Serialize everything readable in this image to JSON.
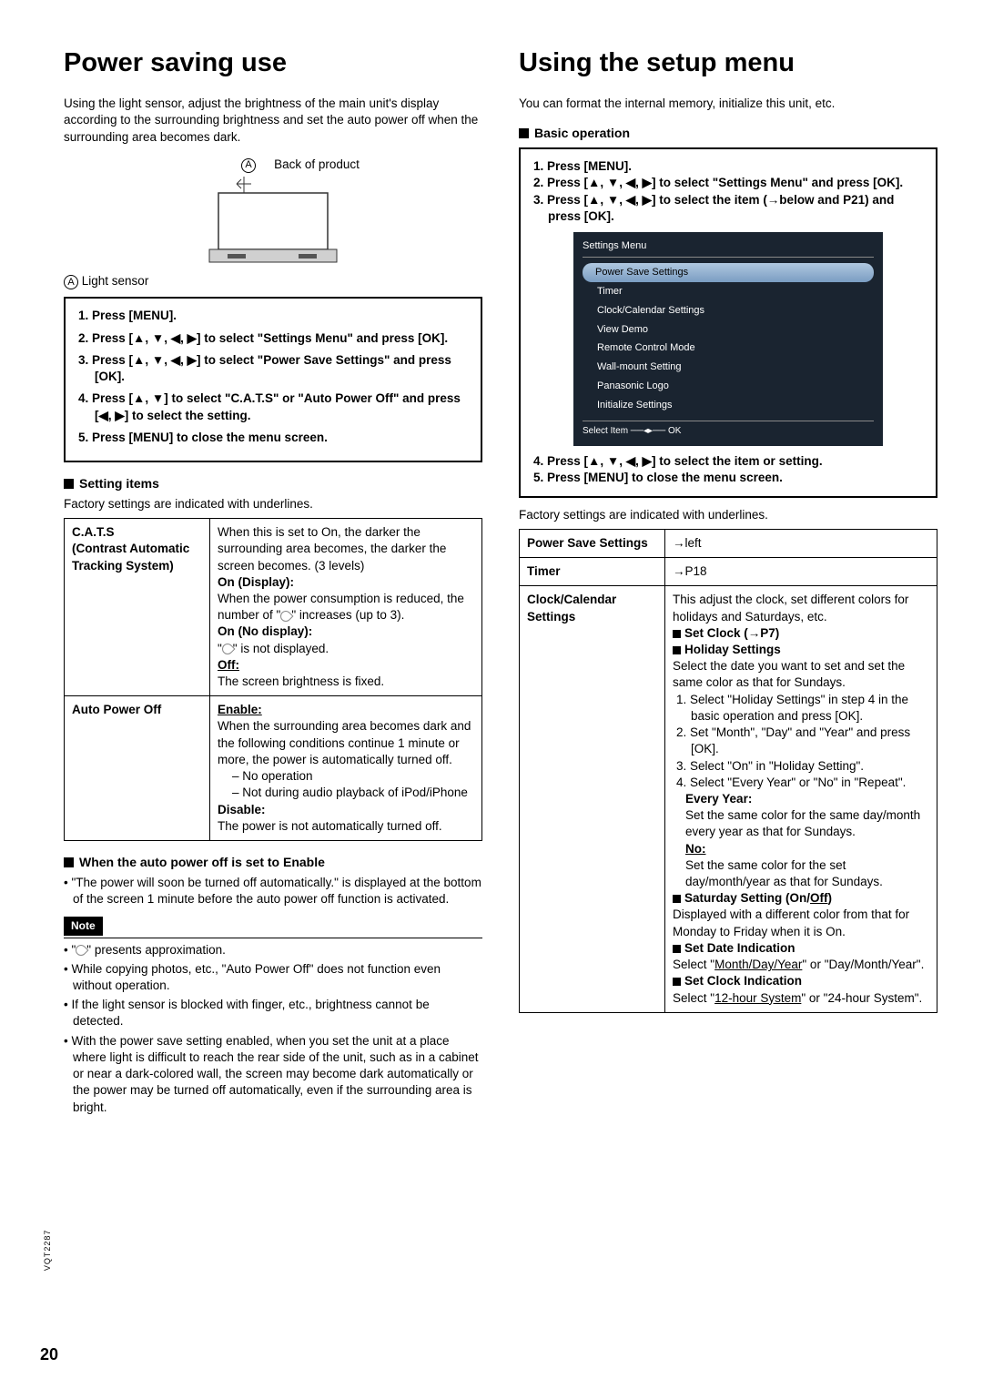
{
  "page_number": "20",
  "doc_code": "VQT2287",
  "left": {
    "title": "Power saving use",
    "intro": "Using the light sensor, adjust the brightness of the main unit's display according to the surrounding brightness and set the auto power off when the surrounding area becomes dark.",
    "back_label": "Back of product",
    "marker": "A",
    "light_sensor": "Light sensor",
    "steps": [
      "Press [MENU].",
      "Press [▲, ▼, ◀, ▶] to select \"Settings Menu\" and press [OK].",
      "Press [▲, ▼, ◀, ▶] to select \"Power Save Settings\" and press [OK].",
      "Press [▲, ▼] to select \"C.A.T.S\" or \"Auto Power Off\" and press [◀, ▶] to select the setting.",
      "Press [MENU] to close the menu screen."
    ],
    "setting_items_head": "Setting items",
    "factory_note": "Factory settings are indicated with underlines.",
    "table": {
      "cats_label": "C.A.T.S\n(Contrast Automatic Tracking System)",
      "cats_desc": {
        "p1": "When this is set to On, the darker the surrounding area becomes, the darker the screen becomes. (3 levels)",
        "on_display": "On (Display):",
        "p2a": "When the power consumption is reduced, the number of \"",
        "p2b": "\" increases (up to 3).",
        "on_nodisplay": "On (No display):",
        "p3a": "\"",
        "p3b": "\" is not displayed.",
        "off": "Off:",
        "p4": "The screen brightness is fixed."
      },
      "apo_label": "Auto Power Off",
      "apo_desc": {
        "enable": "Enable:",
        "p1": "When the surrounding area becomes dark and the following conditions continue 1 minute or more, the power is automatically turned off.",
        "dash1": "No operation",
        "dash2": "Not during audio playback of iPod/iPhone",
        "disable": "Disable:",
        "p2": "The power is not automatically turned off."
      }
    },
    "enable_head": "When the auto power off is set to Enable",
    "enable_bullet": "\"The power will soon be turned off automatically.\" is displayed at the bottom of the screen 1 minute before the auto power off function is activated.",
    "note_label": "Note",
    "note_bullets_a": "\"",
    "note_bullets_b": "\" presents approximation.",
    "note_bullets": [
      "While copying photos, etc., \"Auto Power Off\" does not function even without operation.",
      "If the light sensor is blocked with finger, etc., brightness cannot be detected.",
      "With the power save setting enabled, when you  set the unit at a place where light is difficult to reach the rear side of the unit, such as in a cabinet or near a dark-colored wall, the screen may become dark automatically or the power may be turned off automatically, even if the surrounding area is bright."
    ]
  },
  "right": {
    "title": "Using the setup menu",
    "intro": "You can format the internal memory, initialize this unit, etc.",
    "basic_op": "Basic operation",
    "steps_pre": [
      "Press [MENU].",
      "Press [▲, ▼, ◀, ▶] to select \"Settings Menu\" and press [OK].",
      "Press [▲, ▼, ◀, ▶] to select the item (→below and P21) and press [OK]."
    ],
    "steps_post": [
      "Press [▲, ▼, ◀, ▶] to select the item or setting.",
      "Press [MENU] to close the menu screen."
    ],
    "menu": {
      "title": "Settings Menu",
      "items": [
        "Power Save Settings",
        "Timer",
        "Clock/Calendar Settings",
        "View Demo",
        "Remote Control Mode",
        "Wall-mount Setting",
        "Panasonic Logo",
        "Initialize Settings"
      ],
      "footer": "Select Item ──◂▸── OK"
    },
    "factory_note": "Factory settings are indicated with underlines.",
    "table": {
      "pss": "Power Save Settings",
      "pss_val": "→left",
      "timer": "Timer",
      "timer_val": "→P18",
      "cc": "Clock/Calendar Settings",
      "cc_desc": {
        "p1": "This adjust the clock, set different colors for holidays and Saturdays, etc.",
        "set_clock": "Set Clock (→P7)",
        "holiday": "Holiday Settings",
        "p2": "Select the date you want to set and set the same color as that for Sundays.",
        "ol": [
          "Select \"Holiday Settings\" in step 4 in the basic operation and press [OK].",
          "Set \"Month\", \"Day\" and \"Year\" and press [OK].",
          "Select \"On\" in \"Holiday Setting\".",
          "Select \"Every Year\" or \"No\" in \"Repeat\"."
        ],
        "every_year": "Every Year:",
        "ey_desc": "Set the same color for the same day/month every year as that for Sundays.",
        "no": "No:",
        "no_desc": "Set the same color for the set day/month/year as that for Sundays.",
        "sat": "Saturday Setting (On/",
        "sat_off": "Off",
        "sat_desc": "Displayed with a different color from that for Monday to Friday when it is On.",
        "date_ind": "Set Date Indication",
        "date_pre": "Select \"",
        "date_u": "Month/Day/Year",
        "date_post": "\" or \"Day/Month/Year\".",
        "clock_ind": "Set Clock Indication",
        "clock_pre": "Select \"",
        "clock_u": "12-hour System",
        "clock_post": "\" or \"24-hour System\"."
      }
    }
  }
}
